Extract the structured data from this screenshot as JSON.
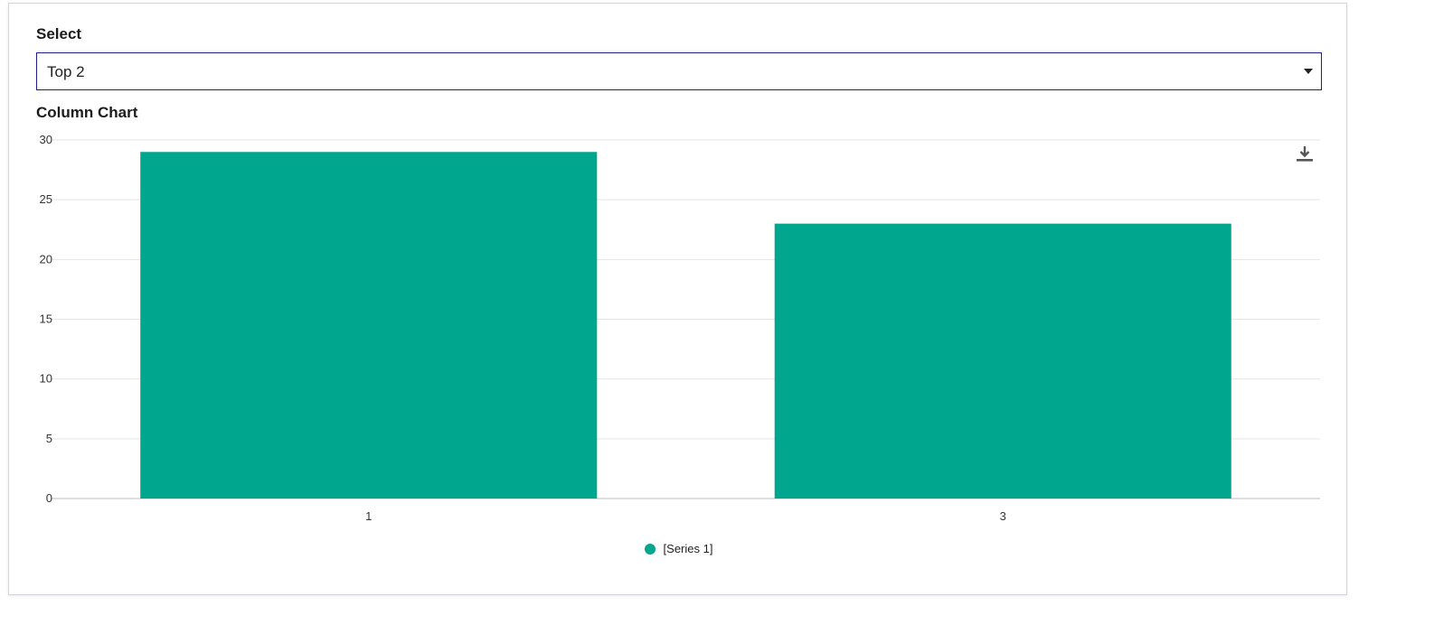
{
  "select": {
    "label": "Select",
    "value": "Top 2"
  },
  "chart": {
    "title": "Column Chart",
    "download_icon": "download-icon"
  },
  "colors": {
    "bar": "#00a78e",
    "select_border": "#1c1f8c"
  },
  "chart_data": {
    "type": "bar",
    "categories": [
      "1",
      "3"
    ],
    "series": [
      {
        "name": "[Series 1]",
        "values": [
          29,
          23
        ]
      }
    ],
    "yticks": [
      0,
      5,
      10,
      15,
      20,
      25,
      30
    ],
    "ylim": [
      0,
      30
    ],
    "xlabel": "",
    "ylabel": "",
    "grid": true,
    "legend_position": "bottom-center"
  }
}
